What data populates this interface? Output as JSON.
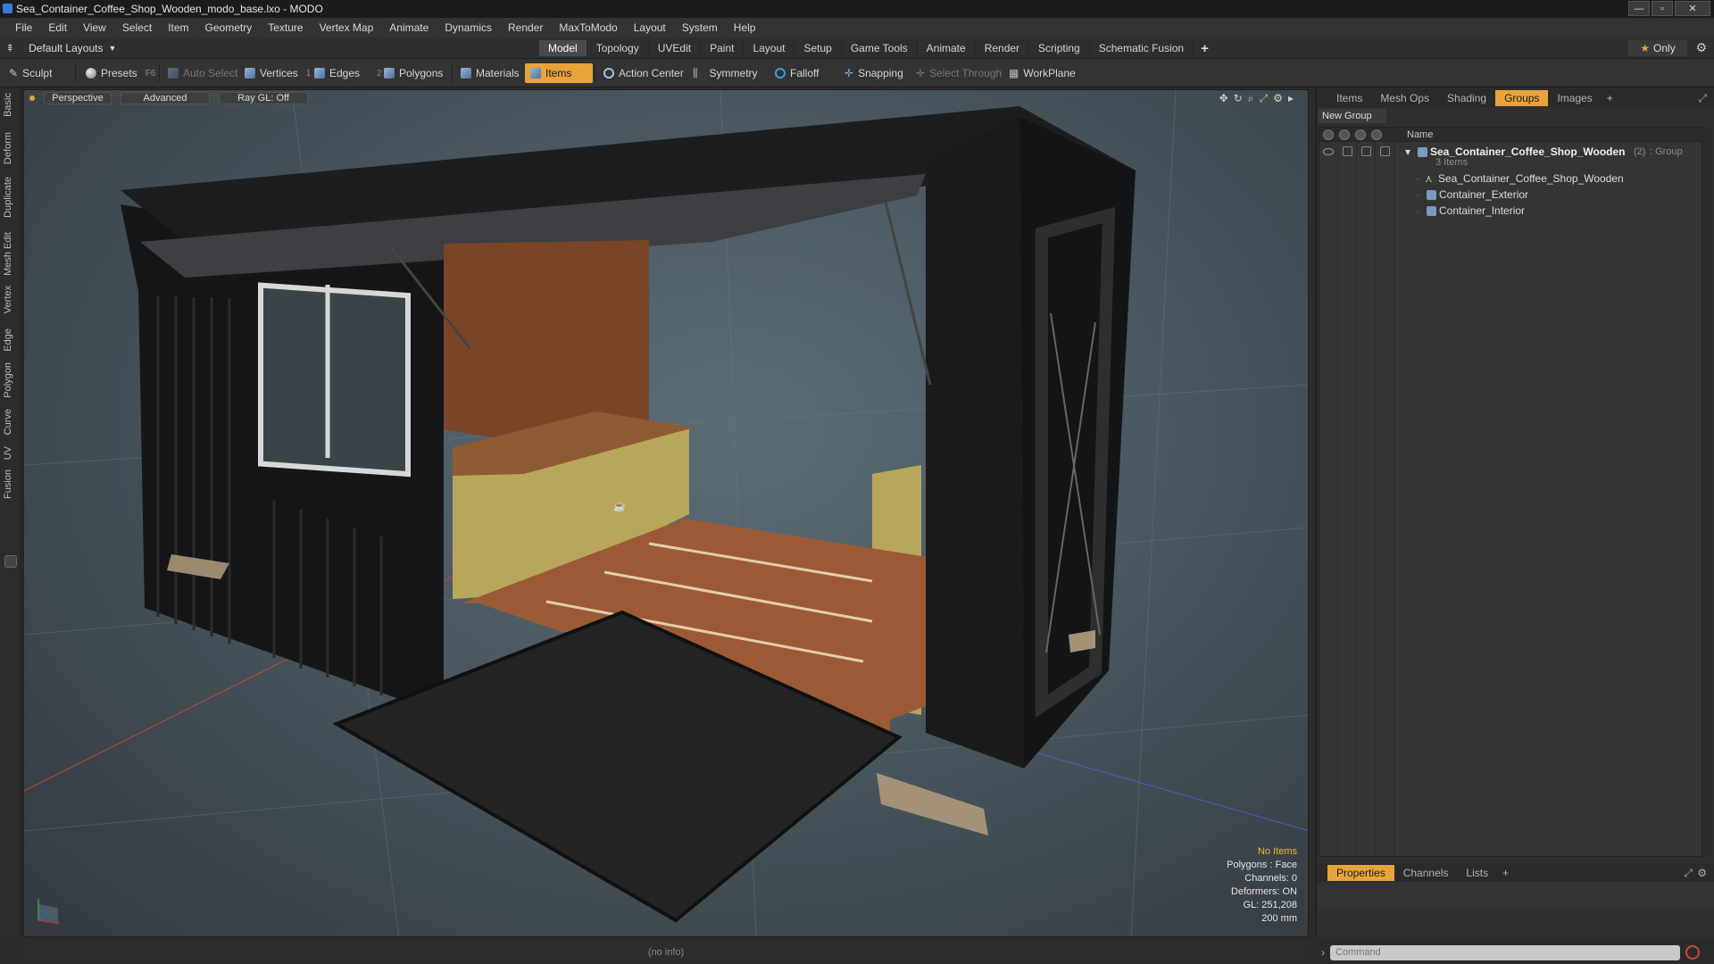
{
  "window": {
    "title": "Sea_Container_Coffee_Shop_Wooden_modo_base.lxo - MODO",
    "minimize": "—",
    "maximize": "▫",
    "close": "✕"
  },
  "menu": [
    "File",
    "Edit",
    "View",
    "Select",
    "Item",
    "Geometry",
    "Texture",
    "Vertex Map",
    "Animate",
    "Dynamics",
    "Render",
    "MaxToModo",
    "Layout",
    "System",
    "Help"
  ],
  "layout": {
    "selector": "Default Layouts",
    "tabs": [
      "Model",
      "Topology",
      "UVEdit",
      "Paint",
      "Layout",
      "Setup",
      "Game Tools",
      "Animate",
      "Render",
      "Scripting",
      "Schematic Fusion"
    ],
    "active_tab": "Model",
    "plus": "+",
    "only": "Only"
  },
  "toolbar": {
    "sculpt": "Sculpt",
    "presets": "Presets",
    "presets_key": "F6",
    "auto_select": "Auto Select",
    "vertices": "Vertices",
    "vertices_num": "1",
    "edges": "Edges",
    "edges_num": "2",
    "polygons": "Polygons",
    "materials": "Materials",
    "items": "Items",
    "action_center": "Action Center",
    "symmetry": "Symmetry",
    "falloff": "Falloff",
    "snapping": "Snapping",
    "select_through": "Select Through",
    "workplane": "WorkPlane"
  },
  "left_tabs": [
    "Basic",
    "Deform",
    "Duplicate",
    "Mesh Edit",
    "Vertex",
    "Edge",
    "Polygon",
    "Curve",
    "UV",
    "Fusion"
  ],
  "viewport": {
    "view": "Perspective",
    "mode": "Advanced",
    "raygl": "Ray GL: Off",
    "stats": {
      "items": "No Items",
      "polygons": "Polygons : Face",
      "channels": "Channels: 0",
      "deformers": "Deformers: ON",
      "gl": "GL: 251,208",
      "size": "200 mm"
    }
  },
  "right_panel": {
    "tabs": [
      "Items",
      "Mesh Ops",
      "Shading",
      "Groups",
      "Images"
    ],
    "active_tab": "Groups",
    "new_group": "New Group",
    "column_name": "Name",
    "group": {
      "name": "Sea_Container_Coffee_Shop_Wooden",
      "count": "(2)",
      "type": ": Group",
      "items_count": "3 Items"
    },
    "children": [
      "Sea_Container_Coffee_Shop_Wooden",
      "Container_Exterior",
      "Container_Interior"
    ],
    "bottom_tabs": [
      "Properties",
      "Channels",
      "Lists"
    ],
    "bottom_active": "Properties"
  },
  "status": {
    "info": "(no info)",
    "command_placeholder": "Command"
  },
  "colors": {
    "accent": "#e8a33d",
    "viewport_bg": "#4f5e68"
  }
}
